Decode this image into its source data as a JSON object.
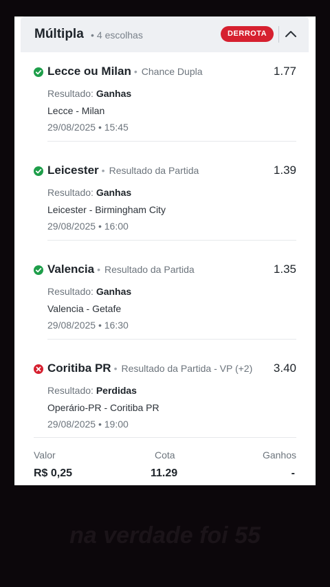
{
  "header": {
    "title": "Múltipla",
    "subtitle": "4 escolhas",
    "badge": "DERROTA",
    "colors": {
      "badge": "#d6202f",
      "header_bg": "#eef0f3"
    }
  },
  "selections": [
    {
      "status": "won",
      "status_icon": "check-circle-icon",
      "team": "Lecce ou Milan",
      "market": "Chance Dupla",
      "odds": "1.77",
      "result_label": "Resultado:",
      "result_value": "Ganhas",
      "match": "Lecce - Milan",
      "datetime": "29/08/2025 • 15:45"
    },
    {
      "status": "won",
      "status_icon": "check-circle-icon",
      "team": "Leicester",
      "market": "Resultado da Partida",
      "odds": "1.39",
      "result_label": "Resultado:",
      "result_value": "Ganhas",
      "match": "Leicester - Birmingham City",
      "datetime": "29/08/2025 • 16:00"
    },
    {
      "status": "won",
      "status_icon": "check-circle-icon",
      "team": "Valencia",
      "market": "Resultado da Partida",
      "odds": "1.35",
      "result_label": "Resultado:",
      "result_value": "Ganhas",
      "match": "Valencia - Getafe",
      "datetime": "29/08/2025 • 16:30"
    },
    {
      "status": "lost",
      "status_icon": "x-circle-icon",
      "team": "Coritiba PR",
      "market": "Resultado da Partida - VP (+2)",
      "odds": "3.40",
      "result_label": "Resultado:",
      "result_value": "Perdidas",
      "match": "Operário-PR - Coritiba PR",
      "datetime": "29/08/2025 • 19:00"
    }
  ],
  "footer": {
    "valor_label": "Valor",
    "valor_value": "R$ 0,25",
    "cota_label": "Cota",
    "cota_value": "11.29",
    "ganhos_label": "Ganhos",
    "ganhos_value": "-"
  },
  "overlay": {
    "caption": "na verdade foi 55"
  },
  "colors": {
    "won": "#1e9e4a",
    "lost": "#d6202f",
    "background": "#0c070b"
  }
}
